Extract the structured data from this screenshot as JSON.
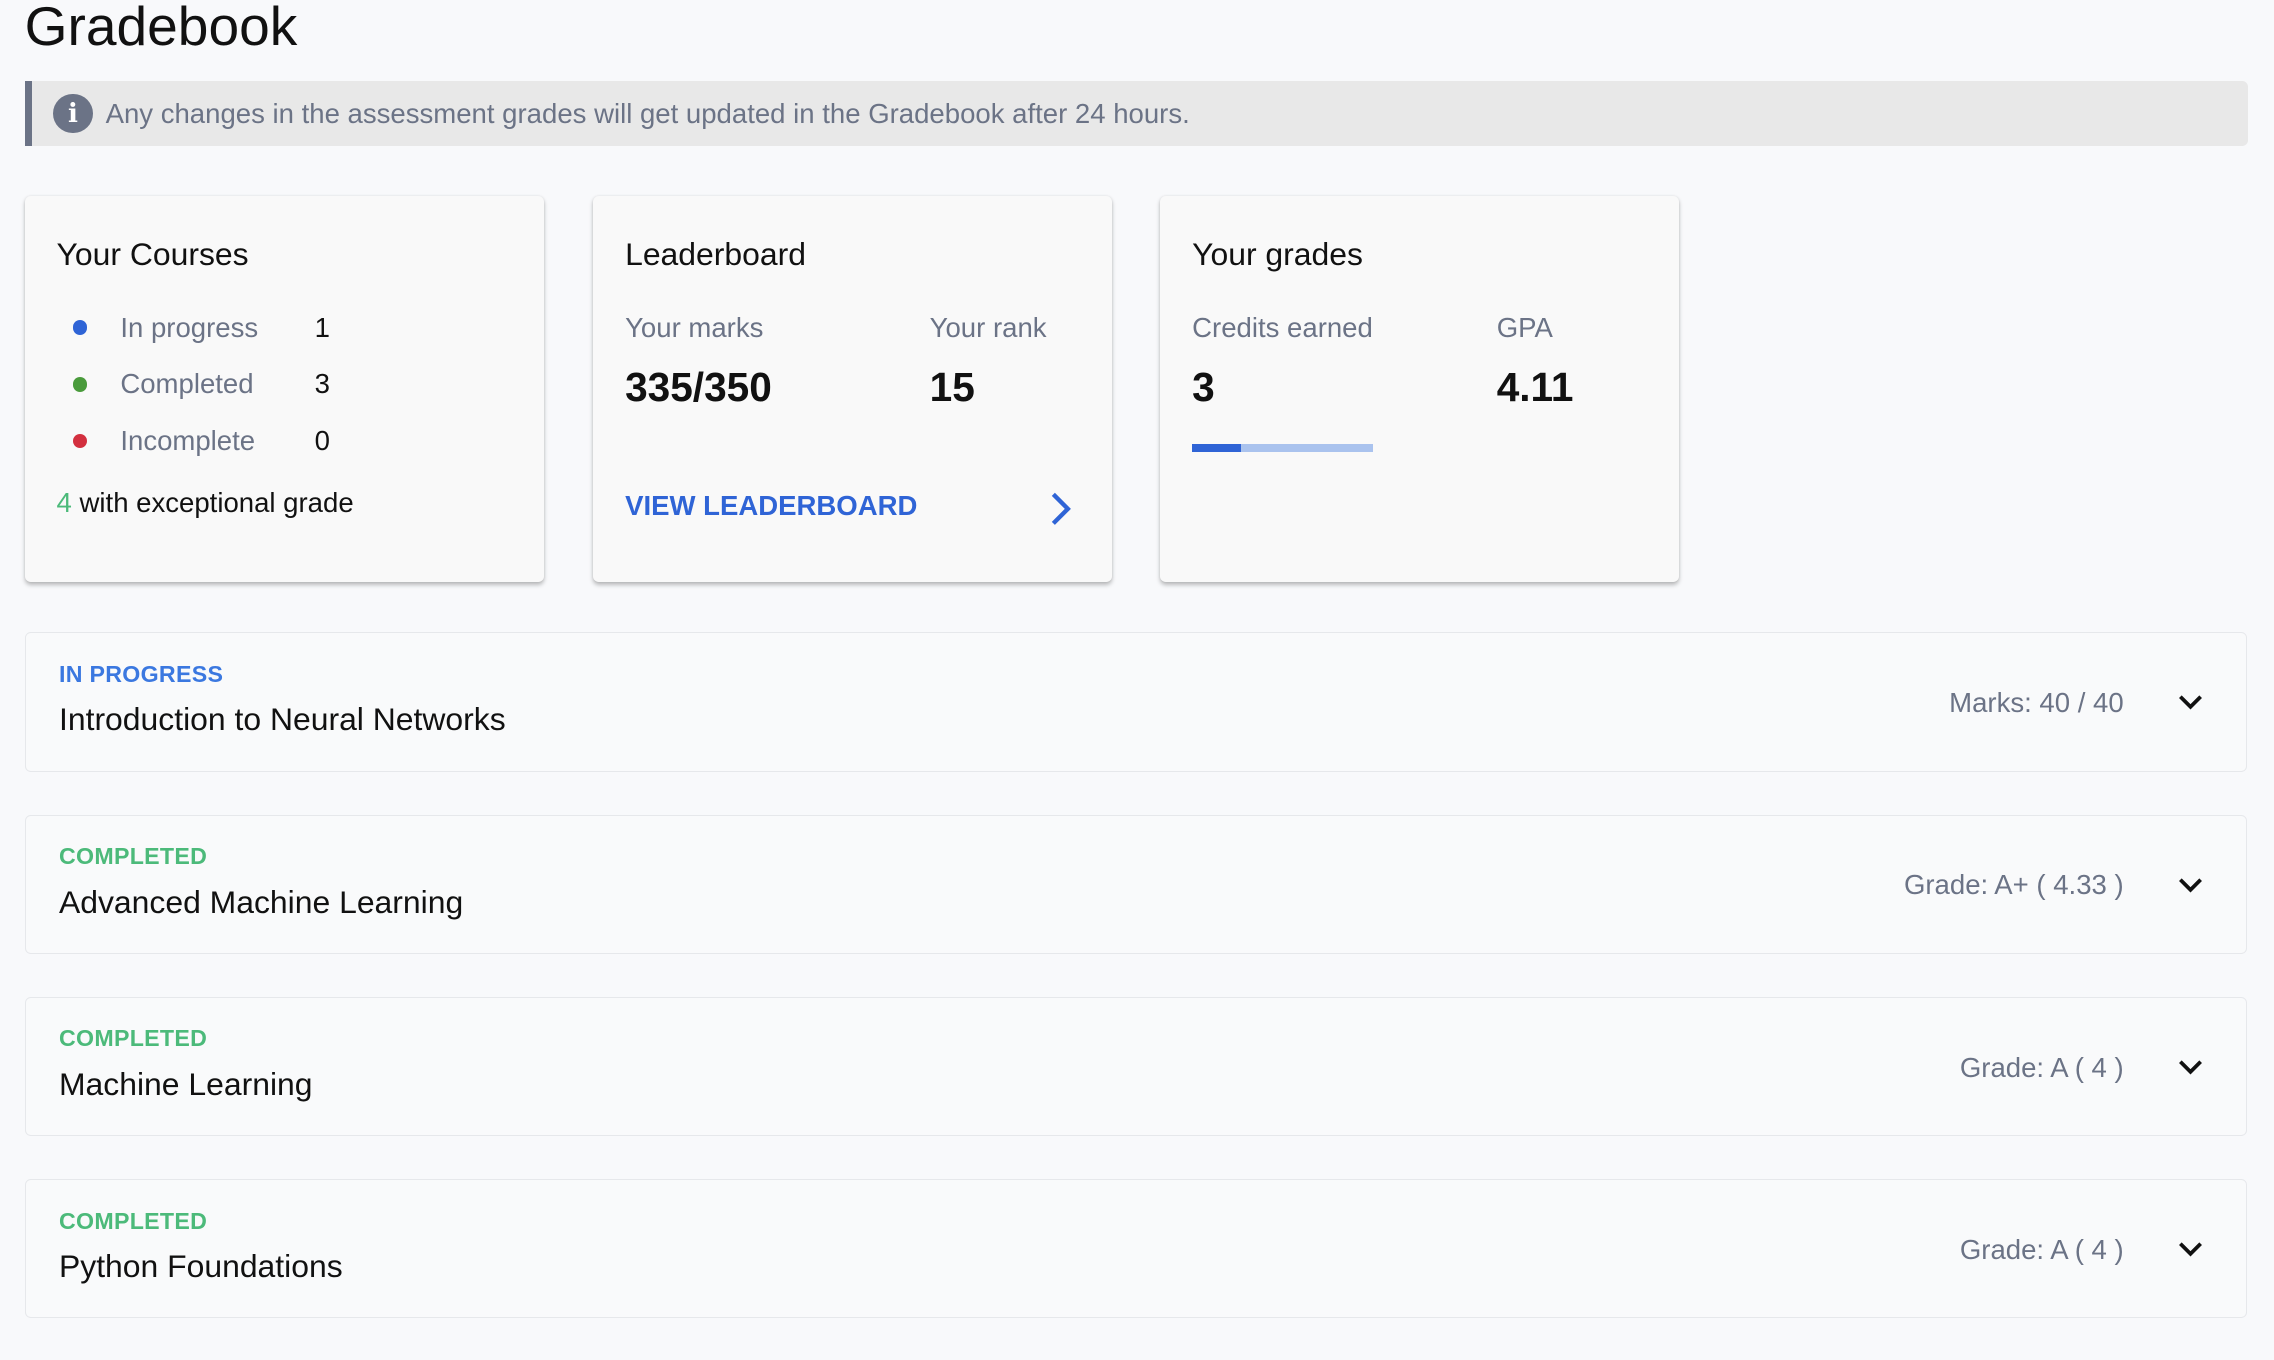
{
  "page": {
    "title": "Gradebook"
  },
  "banner": {
    "icon": "info-icon",
    "text": "Any changes in the assessment grades will get updated in the Gradebook after 24 hours."
  },
  "courses_card": {
    "title": "Your Courses",
    "items": [
      {
        "label": "In progress",
        "count": "1",
        "color": "#2f64d6"
      },
      {
        "label": "Completed",
        "count": "3",
        "color": "#4a9b3c"
      },
      {
        "label": "Incomplete",
        "count": "0",
        "color": "#d3303f"
      }
    ],
    "exceptional_count": "4",
    "exceptional_text": "with exceptional grade"
  },
  "leaderboard_card": {
    "title": "Leaderboard",
    "marks_label": "Your marks",
    "marks_value": "335/350",
    "rank_label": "Your rank",
    "rank_value": "15",
    "link_label": "VIEW LEADERBOARD"
  },
  "grades_card": {
    "title": "Your grades",
    "credits_label": "Credits earned",
    "credits_value": "3",
    "gpa_label": "GPA",
    "gpa_value": "4.11",
    "progress_fraction": 0.27
  },
  "course_list": [
    {
      "status": "IN PROGRESS",
      "status_color": "#3b78e0",
      "name": "Introduction to Neural Networks",
      "meta": "Marks: 40 / 40"
    },
    {
      "status": "COMPLETED",
      "status_color": "#4cba7a",
      "name": "Advanced Machine Learning",
      "meta": "Grade: A+ ( 4.33 )"
    },
    {
      "status": "COMPLETED",
      "status_color": "#4cba7a",
      "name": "Machine Learning",
      "meta": "Grade: A ( 4 )"
    },
    {
      "status": "COMPLETED",
      "status_color": "#4cba7a",
      "name": "Python Foundations",
      "meta": "Grade: A ( 4 )"
    }
  ]
}
